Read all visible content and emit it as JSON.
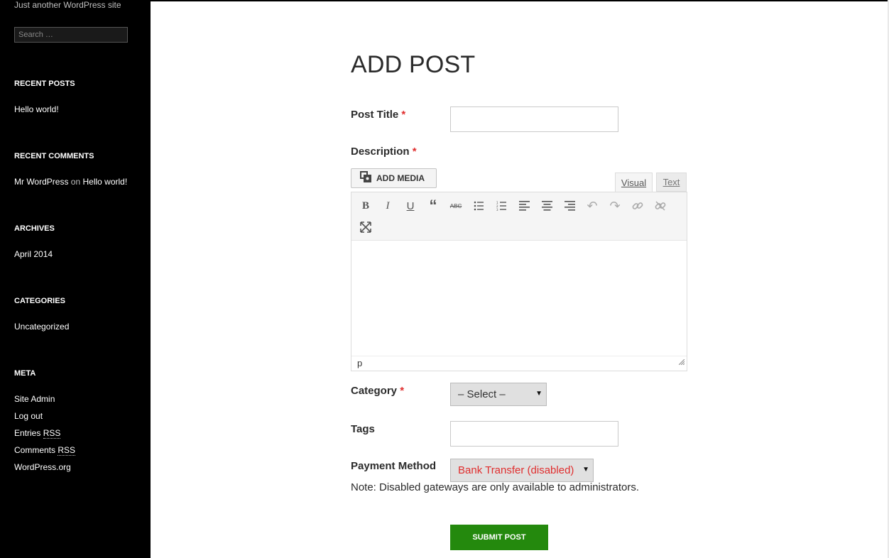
{
  "site": {
    "description": "Just another WordPress site",
    "search_placeholder": "Search …"
  },
  "sidebar": {
    "recent_posts": {
      "title": "RECENT POSTS",
      "items": [
        "Hello world!"
      ]
    },
    "recent_comments": {
      "title": "RECENT COMMENTS",
      "author": "Mr WordPress",
      "on": "on",
      "post": "Hello world!"
    },
    "archives": {
      "title": "ARCHIVES",
      "items": [
        "April 2014"
      ]
    },
    "categories": {
      "title": "CATEGORIES",
      "items": [
        "Uncategorized"
      ]
    },
    "meta": {
      "title": "META",
      "site_admin": "Site Admin",
      "log_out": "Log out",
      "entries": "Entries",
      "comments": "Comments",
      "rss": "RSS",
      "wordpress_org": "WordPress.org"
    }
  },
  "form": {
    "title": "ADD POST",
    "post_title_label": "Post Title",
    "required_mark": "*",
    "description_label": "Description",
    "add_media_label": "ADD MEDIA",
    "tab_visual": "Visual",
    "tab_text": "Text",
    "editor_path": "p",
    "category_label": "Category",
    "category_value": "– Select –",
    "tags_label": "Tags",
    "payment_label": "Payment Method",
    "payment_value": "Bank Transfer (disabled)",
    "note": "Note: Disabled gateways are only available to administrators.",
    "submit_label": "SUBMIT POST"
  },
  "colors": {
    "accent_green": "#24890d",
    "required_red": "#e02e2e",
    "disabled_red": "#e02e2e"
  }
}
